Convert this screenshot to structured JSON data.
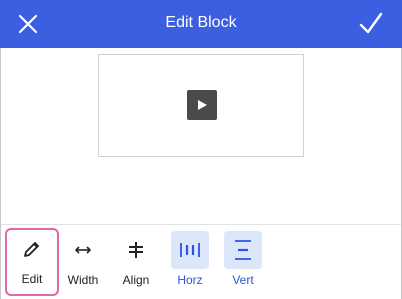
{
  "header": {
    "title": "Edit Block",
    "close_icon": "close-icon",
    "confirm_icon": "checkmark-icon",
    "background": "#3b5fe0"
  },
  "block": {
    "type": "video",
    "play_icon": "play-icon"
  },
  "toolbar": {
    "tools": [
      {
        "label": "Edit",
        "icon": "pencil-icon",
        "state": "selected"
      },
      {
        "label": "Width",
        "icon": "horizontal-arrows-icon",
        "state": "normal"
      },
      {
        "label": "Align",
        "icon": "align-center-icon",
        "state": "normal"
      },
      {
        "label": "Horz",
        "icon": "horizontal-align-icon",
        "state": "active"
      },
      {
        "label": "Vert",
        "icon": "vertical-align-icon",
        "state": "active"
      }
    ],
    "active_color": "#2b55d9",
    "active_bg": "#dbe6fb",
    "selected_border": "#e06aa8"
  }
}
